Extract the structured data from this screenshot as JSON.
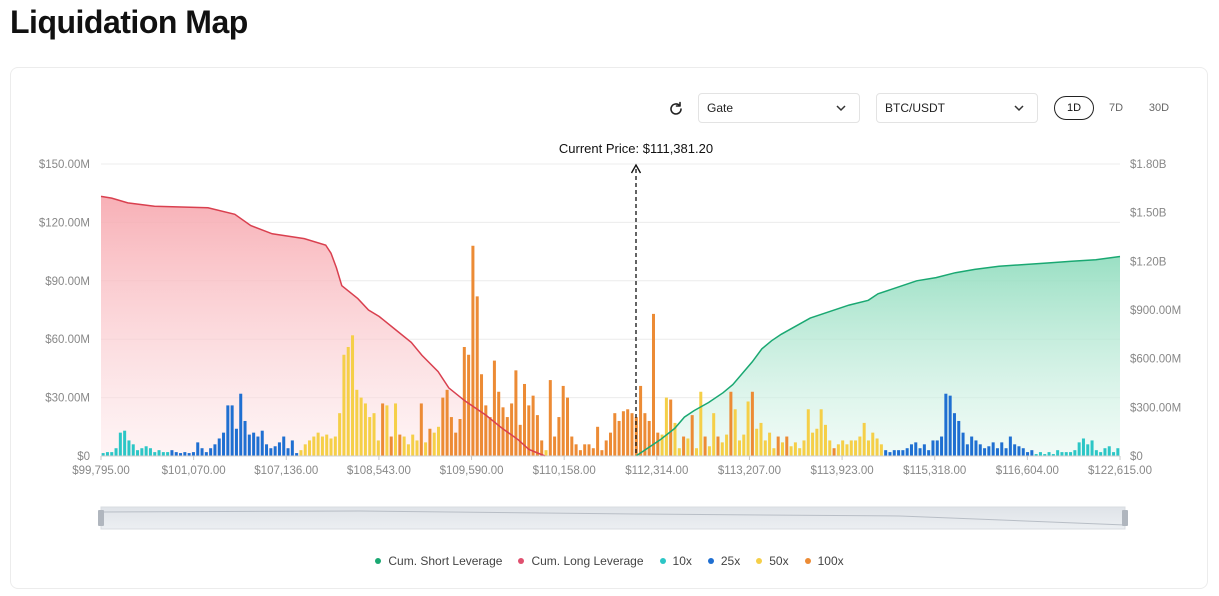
{
  "page": {
    "title": "Liquidation Map"
  },
  "toolbar": {
    "refresh_icon": "refresh-icon",
    "exchange": "Gate",
    "pair": "BTC/USDT",
    "ranges": [
      "1D",
      "7D",
      "30D"
    ],
    "active_range": "1D"
  },
  "colors": {
    "short": "#1aa872",
    "long": "#e05060",
    "x10": "#2cc6c6",
    "x25": "#1f6fd1",
    "x50": "#f5cf48",
    "x100": "#ec8b35"
  },
  "chart_data": {
    "type": "bar",
    "current_price_label": "Current Price: $111,381.20",
    "current_price": 111381.2,
    "y_left": {
      "ticks": [
        "$0",
        "$30.00M",
        "$60.00M",
        "$90.00M",
        "$120.00M",
        "$150.00M"
      ],
      "range": [
        0,
        150
      ]
    },
    "y_right": {
      "ticks": [
        "$0",
        "$300.00M",
        "$600.00M",
        "$900.00M",
        "$1.20B",
        "$1.50B",
        "$1.80B"
      ],
      "range": [
        0,
        1800
      ]
    },
    "x_ticks": [
      "$99,795.00",
      "$101,070.00",
      "$107,136.00",
      "$108,543.00",
      "$109,590.00",
      "$110,158.00",
      "$112,314.00",
      "$113,207.00",
      "$113,923.00",
      "$115,318.00",
      "$116,604.00",
      "$122,615.00"
    ],
    "grid": true,
    "legend": [
      "Cum. Short Leverage",
      "Cum. Long Leverage",
      "10x",
      "25x",
      "50x",
      "100x"
    ],
    "bars": [
      {
        "v": 1.5,
        "l": "10x"
      },
      {
        "v": 2,
        "l": "10x"
      },
      {
        "v": 2,
        "l": "10x"
      },
      {
        "v": 4,
        "l": "10x"
      },
      {
        "v": 12,
        "l": "10x"
      },
      {
        "v": 13,
        "l": "10x"
      },
      {
        "v": 8,
        "l": "10x"
      },
      {
        "v": 6,
        "l": "10x"
      },
      {
        "v": 3,
        "l": "10x"
      },
      {
        "v": 4,
        "l": "10x"
      },
      {
        "v": 5,
        "l": "10x"
      },
      {
        "v": 4,
        "l": "10x"
      },
      {
        "v": 2,
        "l": "10x"
      },
      {
        "v": 3,
        "l": "10x"
      },
      {
        "v": 2,
        "l": "10x"
      },
      {
        "v": 2,
        "l": "10x"
      },
      {
        "v": 3,
        "l": "25x"
      },
      {
        "v": 2,
        "l": "25x"
      },
      {
        "v": 1.5,
        "l": "25x"
      },
      {
        "v": 2,
        "l": "25x"
      },
      {
        "v": 1.5,
        "l": "25x"
      },
      {
        "v": 2,
        "l": "25x"
      },
      {
        "v": 7,
        "l": "25x"
      },
      {
        "v": 4,
        "l": "25x"
      },
      {
        "v": 2,
        "l": "25x"
      },
      {
        "v": 4,
        "l": "25x"
      },
      {
        "v": 6,
        "l": "25x"
      },
      {
        "v": 9,
        "l": "25x"
      },
      {
        "v": 12,
        "l": "25x"
      },
      {
        "v": 26,
        "l": "25x"
      },
      {
        "v": 26,
        "l": "25x"
      },
      {
        "v": 14,
        "l": "25x"
      },
      {
        "v": 32,
        "l": "25x"
      },
      {
        "v": 18,
        "l": "25x"
      },
      {
        "v": 11,
        "l": "25x"
      },
      {
        "v": 12,
        "l": "25x"
      },
      {
        "v": 10,
        "l": "25x"
      },
      {
        "v": 13,
        "l": "25x"
      },
      {
        "v": 6,
        "l": "25x"
      },
      {
        "v": 4,
        "l": "25x"
      },
      {
        "v": 5,
        "l": "25x"
      },
      {
        "v": 7,
        "l": "25x"
      },
      {
        "v": 10,
        "l": "25x"
      },
      {
        "v": 4,
        "l": "25x"
      },
      {
        "v": 8,
        "l": "25x"
      },
      {
        "v": 1.5,
        "l": "25x"
      },
      {
        "v": 3,
        "l": "50x"
      },
      {
        "v": 6,
        "l": "50x"
      },
      {
        "v": 8,
        "l": "50x"
      },
      {
        "v": 10,
        "l": "50x"
      },
      {
        "v": 12,
        "l": "50x"
      },
      {
        "v": 10,
        "l": "50x"
      },
      {
        "v": 11,
        "l": "50x"
      },
      {
        "v": 9,
        "l": "50x"
      },
      {
        "v": 10,
        "l": "50x"
      },
      {
        "v": 22,
        "l": "50x"
      },
      {
        "v": 52,
        "l": "50x"
      },
      {
        "v": 56,
        "l": "50x"
      },
      {
        "v": 62,
        "l": "50x"
      },
      {
        "v": 34,
        "l": "50x"
      },
      {
        "v": 30,
        "l": "50x"
      },
      {
        "v": 27,
        "l": "50x"
      },
      {
        "v": 20,
        "l": "50x"
      },
      {
        "v": 22,
        "l": "50x"
      },
      {
        "v": 8,
        "l": "50x"
      },
      {
        "v": 27,
        "l": "100x"
      },
      {
        "v": 26,
        "l": "50x"
      },
      {
        "v": 10,
        "l": "100x"
      },
      {
        "v": 27,
        "l": "50x"
      },
      {
        "v": 11,
        "l": "100x"
      },
      {
        "v": 10,
        "l": "50x"
      },
      {
        "v": 6,
        "l": "50x"
      },
      {
        "v": 11,
        "l": "50x"
      },
      {
        "v": 8,
        "l": "50x"
      },
      {
        "v": 27,
        "l": "100x"
      },
      {
        "v": 7,
        "l": "50x"
      },
      {
        "v": 14,
        "l": "100x"
      },
      {
        "v": 12,
        "l": "50x"
      },
      {
        "v": 15,
        "l": "50x"
      },
      {
        "v": 30,
        "l": "100x"
      },
      {
        "v": 34,
        "l": "100x"
      },
      {
        "v": 20,
        "l": "100x"
      },
      {
        "v": 12,
        "l": "100x"
      },
      {
        "v": 19,
        "l": "100x"
      },
      {
        "v": 56,
        "l": "100x"
      },
      {
        "v": 52,
        "l": "100x"
      },
      {
        "v": 108,
        "l": "100x"
      },
      {
        "v": 82,
        "l": "100x"
      },
      {
        "v": 42,
        "l": "100x"
      },
      {
        "v": 26,
        "l": "100x"
      },
      {
        "v": 20,
        "l": "100x"
      },
      {
        "v": 49,
        "l": "100x"
      },
      {
        "v": 33,
        "l": "100x"
      },
      {
        "v": 25,
        "l": "100x"
      },
      {
        "v": 20,
        "l": "100x"
      },
      {
        "v": 27,
        "l": "100x"
      },
      {
        "v": 44,
        "l": "100x"
      },
      {
        "v": 16,
        "l": "100x"
      },
      {
        "v": 37,
        "l": "100x"
      },
      {
        "v": 26,
        "l": "100x"
      },
      {
        "v": 31,
        "l": "100x"
      },
      {
        "v": 21,
        "l": "100x"
      },
      {
        "v": 8,
        "l": "100x"
      },
      {
        "v": 3,
        "l": "50x"
      },
      {
        "v": 39,
        "l": "100x"
      },
      {
        "v": 10,
        "l": "100x"
      },
      {
        "v": 20,
        "l": "100x"
      },
      {
        "v": 36,
        "l": "100x"
      },
      {
        "v": 30,
        "l": "100x"
      },
      {
        "v": 10,
        "l": "100x"
      },
      {
        "v": 6,
        "l": "100x"
      },
      {
        "v": 3,
        "l": "100x"
      },
      {
        "v": 6,
        "l": "100x"
      },
      {
        "v": 6,
        "l": "100x"
      },
      {
        "v": 4,
        "l": "100x"
      },
      {
        "v": 15,
        "l": "100x"
      },
      {
        "v": 3,
        "l": "100x"
      },
      {
        "v": 8,
        "l": "100x"
      },
      {
        "v": 12,
        "l": "100x"
      },
      {
        "v": 22,
        "l": "100x"
      },
      {
        "v": 18,
        "l": "100x"
      },
      {
        "v": 23,
        "l": "100x"
      },
      {
        "v": 24,
        "l": "100x"
      },
      {
        "v": 22,
        "l": "100x"
      },
      {
        "v": 20,
        "l": "100x"
      },
      {
        "v": 36,
        "l": "100x"
      },
      {
        "v": 22,
        "l": "100x"
      },
      {
        "v": 18,
        "l": "100x"
      },
      {
        "v": 73,
        "l": "100x"
      },
      {
        "v": 12,
        "l": "100x"
      },
      {
        "v": 11,
        "l": "50x"
      },
      {
        "v": 30,
        "l": "50x"
      },
      {
        "v": 29,
        "l": "100x"
      },
      {
        "v": 17,
        "l": "50x"
      },
      {
        "v": 4,
        "l": "50x"
      },
      {
        "v": 10,
        "l": "100x"
      },
      {
        "v": 9,
        "l": "50x"
      },
      {
        "v": 21,
        "l": "100x"
      },
      {
        "v": 4,
        "l": "50x"
      },
      {
        "v": 33,
        "l": "50x"
      },
      {
        "v": 10,
        "l": "100x"
      },
      {
        "v": 5,
        "l": "50x"
      },
      {
        "v": 22,
        "l": "50x"
      },
      {
        "v": 10,
        "l": "100x"
      },
      {
        "v": 7,
        "l": "50x"
      },
      {
        "v": 11,
        "l": "50x"
      },
      {
        "v": 33,
        "l": "100x"
      },
      {
        "v": 24,
        "l": "50x"
      },
      {
        "v": 8,
        "l": "50x"
      },
      {
        "v": 11,
        "l": "50x"
      },
      {
        "v": 28,
        "l": "50x"
      },
      {
        "v": 33,
        "l": "100x"
      },
      {
        "v": 14,
        "l": "50x"
      },
      {
        "v": 17,
        "l": "50x"
      },
      {
        "v": 8,
        "l": "50x"
      },
      {
        "v": 12,
        "l": "50x"
      },
      {
        "v": 4,
        "l": "50x"
      },
      {
        "v": 10,
        "l": "100x"
      },
      {
        "v": 7,
        "l": "50x"
      },
      {
        "v": 10,
        "l": "100x"
      },
      {
        "v": 5,
        "l": "50x"
      },
      {
        "v": 7,
        "l": "50x"
      },
      {
        "v": 4,
        "l": "50x"
      },
      {
        "v": 8,
        "l": "50x"
      },
      {
        "v": 24,
        "l": "50x"
      },
      {
        "v": 12,
        "l": "50x"
      },
      {
        "v": 14,
        "l": "50x"
      },
      {
        "v": 24,
        "l": "50x"
      },
      {
        "v": 16,
        "l": "50x"
      },
      {
        "v": 8,
        "l": "50x"
      },
      {
        "v": 4,
        "l": "100x"
      },
      {
        "v": 6,
        "l": "50x"
      },
      {
        "v": 8,
        "l": "50x"
      },
      {
        "v": 6,
        "l": "50x"
      },
      {
        "v": 8,
        "l": "50x"
      },
      {
        "v": 8,
        "l": "50x"
      },
      {
        "v": 10,
        "l": "50x"
      },
      {
        "v": 17,
        "l": "50x"
      },
      {
        "v": 8,
        "l": "50x"
      },
      {
        "v": 12,
        "l": "50x"
      },
      {
        "v": 9,
        "l": "50x"
      },
      {
        "v": 6,
        "l": "50x"
      },
      {
        "v": 3,
        "l": "25x"
      },
      {
        "v": 2,
        "l": "25x"
      },
      {
        "v": 3,
        "l": "25x"
      },
      {
        "v": 3,
        "l": "25x"
      },
      {
        "v": 3,
        "l": "25x"
      },
      {
        "v": 4,
        "l": "25x"
      },
      {
        "v": 6,
        "l": "25x"
      },
      {
        "v": 7,
        "l": "25x"
      },
      {
        "v": 4,
        "l": "25x"
      },
      {
        "v": 6,
        "l": "25x"
      },
      {
        "v": 3,
        "l": "25x"
      },
      {
        "v": 8,
        "l": "25x"
      },
      {
        "v": 8,
        "l": "25x"
      },
      {
        "v": 10,
        "l": "25x"
      },
      {
        "v": 32,
        "l": "25x"
      },
      {
        "v": 31,
        "l": "25x"
      },
      {
        "v": 22,
        "l": "25x"
      },
      {
        "v": 18,
        "l": "25x"
      },
      {
        "v": 12,
        "l": "25x"
      },
      {
        "v": 6,
        "l": "25x"
      },
      {
        "v": 10,
        "l": "25x"
      },
      {
        "v": 8,
        "l": "25x"
      },
      {
        "v": 6,
        "l": "25x"
      },
      {
        "v": 4,
        "l": "25x"
      },
      {
        "v": 5,
        "l": "25x"
      },
      {
        "v": 7,
        "l": "25x"
      },
      {
        "v": 4,
        "l": "25x"
      },
      {
        "v": 7,
        "l": "25x"
      },
      {
        "v": 4,
        "l": "25x"
      },
      {
        "v": 10,
        "l": "25x"
      },
      {
        "v": 6,
        "l": "25x"
      },
      {
        "v": 5,
        "l": "25x"
      },
      {
        "v": 4,
        "l": "25x"
      },
      {
        "v": 2,
        "l": "25x"
      },
      {
        "v": 3,
        "l": "25x"
      },
      {
        "v": 1,
        "l": "10x"
      },
      {
        "v": 2,
        "l": "10x"
      },
      {
        "v": 1,
        "l": "10x"
      },
      {
        "v": 2,
        "l": "10x"
      },
      {
        "v": 1,
        "l": "10x"
      },
      {
        "v": 3,
        "l": "10x"
      },
      {
        "v": 2,
        "l": "10x"
      },
      {
        "v": 2,
        "l": "10x"
      },
      {
        "v": 2,
        "l": "10x"
      },
      {
        "v": 3,
        "l": "10x"
      },
      {
        "v": 7,
        "l": "10x"
      },
      {
        "v": 9,
        "l": "10x"
      },
      {
        "v": 6,
        "l": "10x"
      },
      {
        "v": 8,
        "l": "10x"
      },
      {
        "v": 3,
        "l": "10x"
      },
      {
        "v": 2,
        "l": "10x"
      },
      {
        "v": 4,
        "l": "10x"
      },
      {
        "v": 5,
        "l": "10x"
      },
      {
        "v": 2,
        "l": "10x"
      },
      {
        "v": 4,
        "l": "10x"
      }
    ],
    "cum_long": [
      [
        0,
        1600
      ],
      [
        0.02,
        1590
      ],
      [
        0.05,
        1560
      ],
      [
        0.1,
        1540
      ],
      [
        0.2,
        1530
      ],
      [
        0.25,
        1490
      ],
      [
        0.28,
        1420
      ],
      [
        0.32,
        1370
      ],
      [
        0.38,
        1340
      ],
      [
        0.42,
        1300
      ],
      [
        0.43,
        1250
      ],
      [
        0.44,
        1160
      ],
      [
        0.45,
        1050
      ],
      [
        0.48,
        970
      ],
      [
        0.5,
        900
      ],
      [
        0.52,
        860
      ],
      [
        0.55,
        780
      ],
      [
        0.58,
        700
      ],
      [
        0.6,
        620
      ],
      [
        0.63,
        520
      ],
      [
        0.65,
        420
      ],
      [
        0.68,
        340
      ],
      [
        0.72,
        250
      ],
      [
        0.75,
        170
      ],
      [
        0.78,
        100
      ],
      [
        0.8,
        40
      ],
      [
        0.83,
        0
      ]
    ],
    "cum_short": [
      [
        0,
        0
      ],
      [
        0.02,
        40
      ],
      [
        0.05,
        100
      ],
      [
        0.08,
        170
      ],
      [
        0.1,
        240
      ],
      [
        0.12,
        280
      ],
      [
        0.15,
        330
      ],
      [
        0.18,
        390
      ],
      [
        0.2,
        440
      ],
      [
        0.22,
        510
      ],
      [
        0.24,
        580
      ],
      [
        0.26,
        660
      ],
      [
        0.28,
        710
      ],
      [
        0.3,
        750
      ],
      [
        0.33,
        800
      ],
      [
        0.36,
        850
      ],
      [
        0.4,
        890
      ],
      [
        0.44,
        930
      ],
      [
        0.48,
        960
      ],
      [
        0.5,
        1000
      ],
      [
        0.54,
        1040
      ],
      [
        0.58,
        1080
      ],
      [
        0.62,
        1100
      ],
      [
        0.66,
        1130
      ],
      [
        0.7,
        1150
      ],
      [
        0.75,
        1170
      ],
      [
        0.8,
        1180
      ],
      [
        0.85,
        1190
      ],
      [
        0.9,
        1200
      ],
      [
        0.95,
        1210
      ],
      [
        1,
        1230
      ]
    ]
  }
}
